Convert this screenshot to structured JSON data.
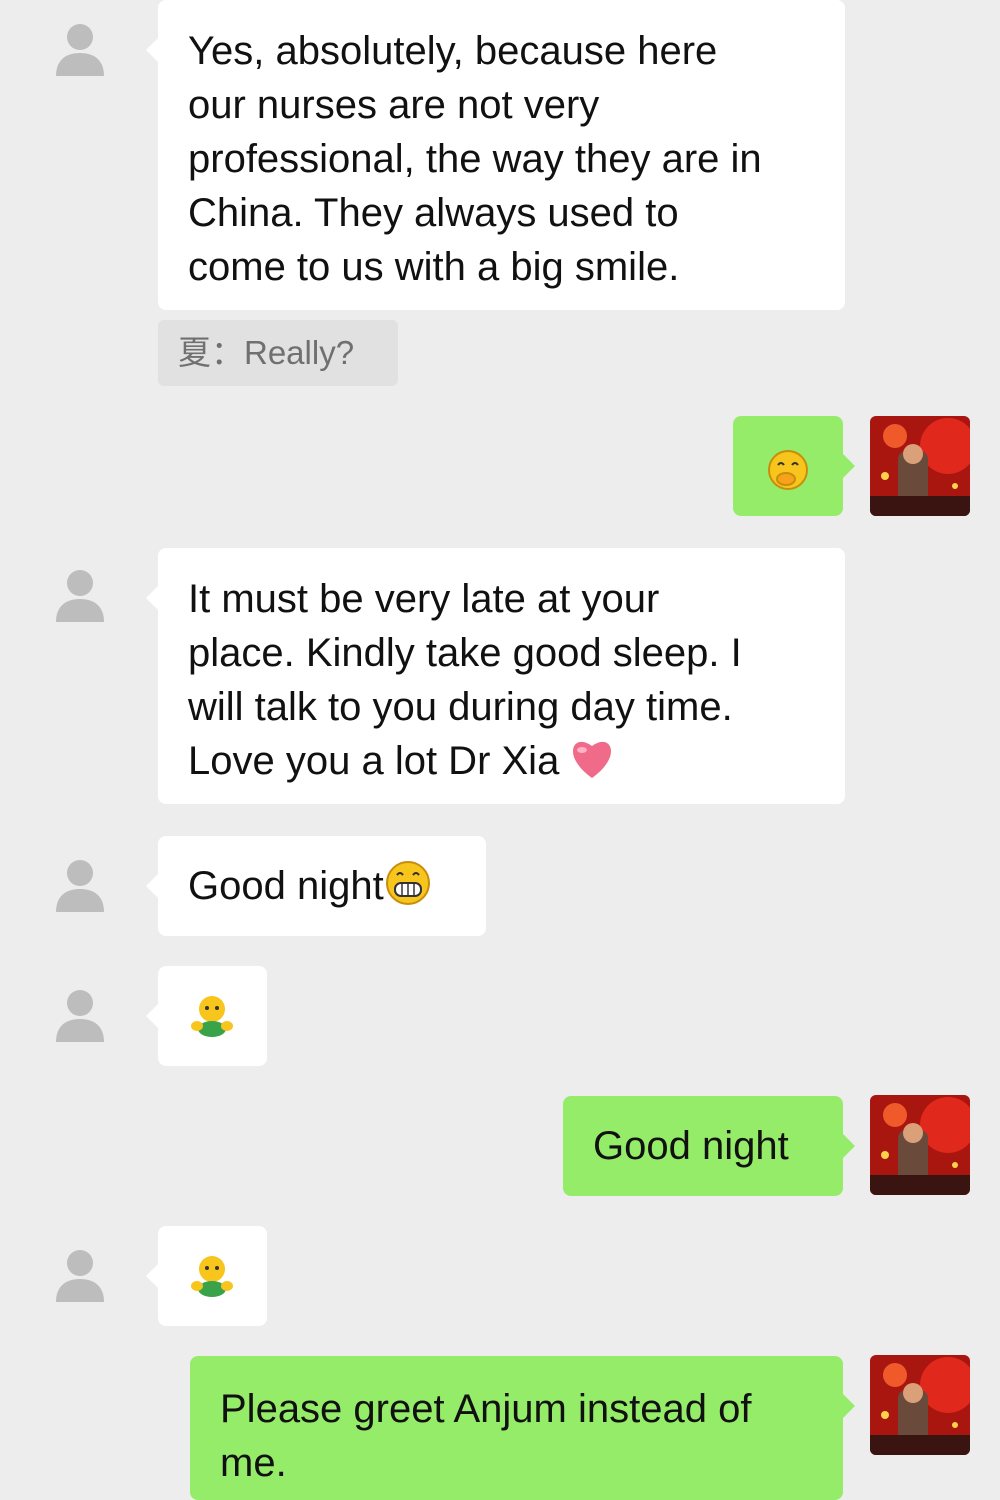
{
  "messages": [
    {
      "side": "in",
      "text": "Yes, absolutely, because here\nour nurses are not very\nprofessional, the way they are in\nChina. They always used to\ncome to us with a big smile."
    },
    {
      "quote": "夏：Really?"
    },
    {
      "side": "out",
      "emoji": "chuckle-emoji"
    },
    {
      "side": "in",
      "text": "It must be very late at your\nplace. Kindly take good sleep. I\nwill talk to you during day time.\nLove you a lot Dr Xia",
      "emoji": "heart-emoji"
    },
    {
      "side": "in",
      "text": "Good night",
      "emoji": "grin-emoji"
    },
    {
      "side": "in",
      "emoji": "hug-emoji"
    },
    {
      "side": "out",
      "text": "Good night"
    },
    {
      "side": "in",
      "emoji": "hug-emoji"
    },
    {
      "side": "out",
      "text": "Please greet Anjum instead of\nme."
    }
  ],
  "colors": {
    "background": "#ededed",
    "incoming_bubble": "#ffffff",
    "outgoing_bubble": "#95ec69",
    "quote_bg": "#e1e1e1"
  }
}
